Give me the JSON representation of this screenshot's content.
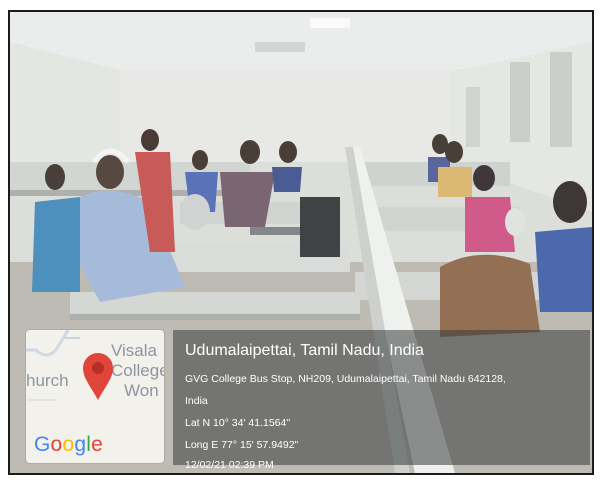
{
  "map": {
    "labels": [
      "Visala",
      "College",
      "Won",
      "hurch"
    ],
    "logo_letters": [
      {
        "ch": "G",
        "color": "#4285F4"
      },
      {
        "ch": "o",
        "color": "#EA4335"
      },
      {
        "ch": "o",
        "color": "#FBBC05"
      },
      {
        "ch": "g",
        "color": "#4285F4"
      },
      {
        "ch": "l",
        "color": "#34A853"
      },
      {
        "ch": "e",
        "color": "#EA4335"
      }
    ],
    "pin_color": "#E0453A"
  },
  "overlay": {
    "place": "Udumalaipettai, Tamil Nadu, India",
    "address_line1": "GVG College Bus Stop, NH209, Udumalaipettai, Tamil Nadu 642128,",
    "address_line2": "India",
    "latitude": "Lat N 10° 34' 41.1564\"",
    "longitude": "Long E 77° 15' 57.9492\"",
    "datetime": "12/02/21 02:39 PM"
  }
}
